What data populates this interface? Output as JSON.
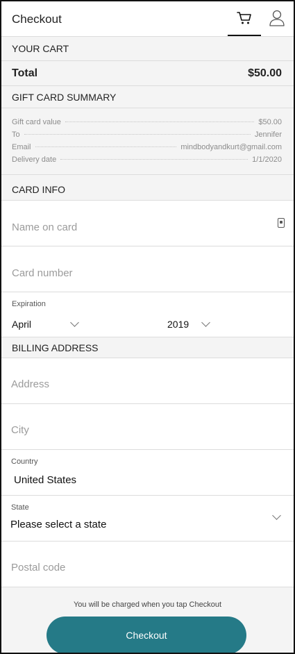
{
  "header": {
    "title": "Checkout",
    "cart_icon": "shopping-cart-icon",
    "user_icon": "user-profile-icon"
  },
  "cart": {
    "heading": "YOUR CART",
    "total_label": "Total",
    "total_value": "$50.00"
  },
  "gift_card_summary": {
    "heading": "GIFT CARD SUMMARY",
    "rows": [
      {
        "label": "Gift card value",
        "value": "$50.00"
      },
      {
        "label": "To",
        "value": "Jennifer"
      },
      {
        "label": "Email",
        "value": "mindbodyandkurt@gmail.com"
      },
      {
        "label": "Delivery date",
        "value": "1/1/2020"
      }
    ]
  },
  "card_info": {
    "heading": "CARD INFO",
    "name_placeholder": "Name on card",
    "number_placeholder": "Card number",
    "expiration_label": "Expiration",
    "month": "April",
    "year": "2019"
  },
  "billing": {
    "heading": "BILLING ADDRESS",
    "address_placeholder": "Address",
    "city_placeholder": "City",
    "country_label": "Country",
    "country_value": "United States",
    "state_label": "State",
    "state_value": "Please select a state",
    "postal_placeholder": "Postal code"
  },
  "footer": {
    "note": "You will be charged when you tap Checkout",
    "checkout_label": "Checkout"
  },
  "colors": {
    "accent": "#257a87",
    "section_bg": "#f4f4f4",
    "divider": "#dcdcdc"
  }
}
